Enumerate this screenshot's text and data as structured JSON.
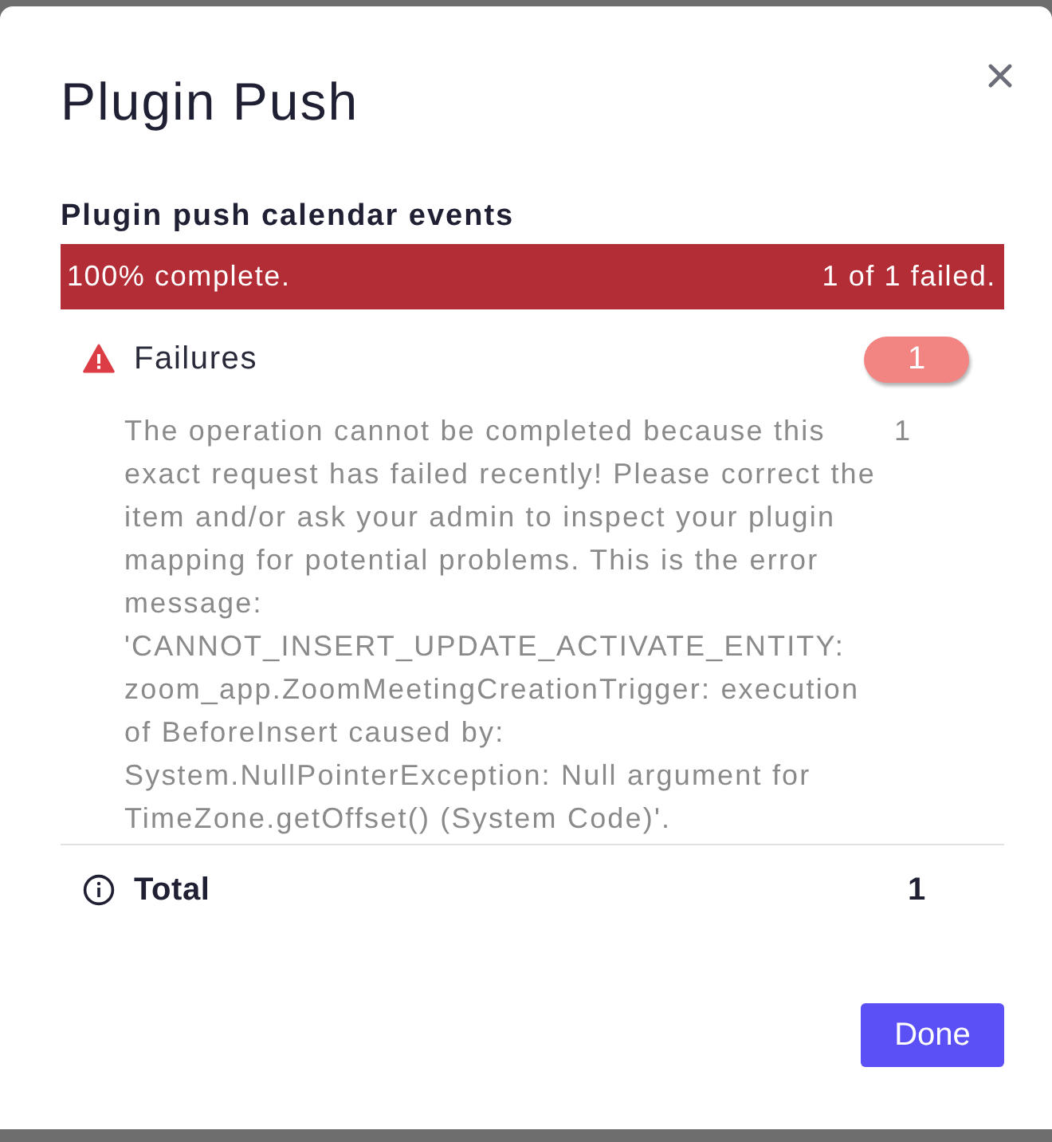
{
  "dialog": {
    "title": "Plugin Push"
  },
  "task": {
    "title": "Plugin push calendar events",
    "progress": {
      "level": 1,
      "failed": true,
      "status": "100% complete.",
      "summary": "1 of 1 failed."
    }
  },
  "failures": {
    "label": "Failures",
    "count": "1",
    "items": [
      {
        "message": "The operation cannot be completed because this exact request has failed recently! Please correct the item and/or ask your admin to inspect your plugin mapping for potential problems. This is the error message: 'CANNOT_INSERT_UPDATE_ACTIVATE_ENTITY: zoom_app.ZoomMeetingCreationTrigger: execution of BeforeInsert caused by: System.NullPointerException: Null argument for TimeZone.getOffset() (System Code)'.",
        "count": "1"
      }
    ]
  },
  "total": {
    "label": "Total",
    "value": "1"
  },
  "buttons": [
    {
      "label": "Done"
    }
  ]
}
